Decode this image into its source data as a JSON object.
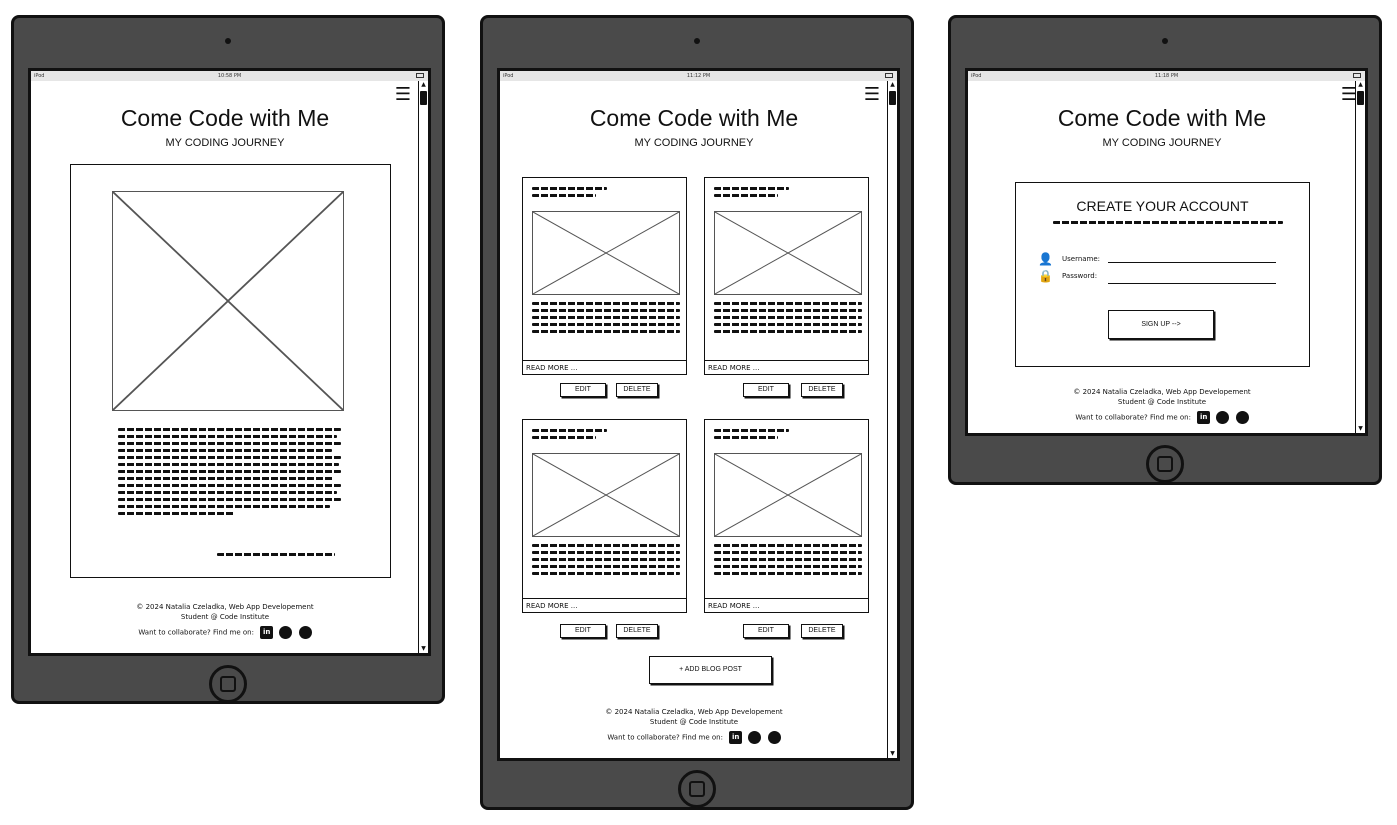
{
  "brand": {
    "title": "Come Code with Me",
    "subtitle": "MY CODING JOURNEY"
  },
  "status": {
    "device": "iPod",
    "time_tablet1": "10:58 PM",
    "time_tablet2": "11:12 PM",
    "time_tablet3": "11:18 PM"
  },
  "icons": {
    "menu": "hamburger-menu-icon",
    "placeholder": "image-placeholder-icon",
    "user": "user-add-icon",
    "lock": "lock-icon",
    "linkedin": "linkedin-icon",
    "github": "github-icon",
    "facebook": "facebook-icon"
  },
  "footer": {
    "line1": "© 2024 Natalia Czeladka, Web App Developement",
    "line2": "Student @ Code Institute",
    "line3": "Want to collaborate? Find me on:",
    "linkedin_label": "in"
  },
  "blog": {
    "read_more": "READ MORE ...",
    "edit": "EDIT",
    "delete": "DELETE",
    "add_post": "+ ADD BLOG POST"
  },
  "signup": {
    "heading": "CREATE YOUR ACCOUNT",
    "username_label": "Username:",
    "password_label": "Password:",
    "button": "SIGN UP -->"
  },
  "colors": {
    "bezel": "#4a4a4a",
    "outline": "#111111",
    "screen": "#ffffff"
  }
}
